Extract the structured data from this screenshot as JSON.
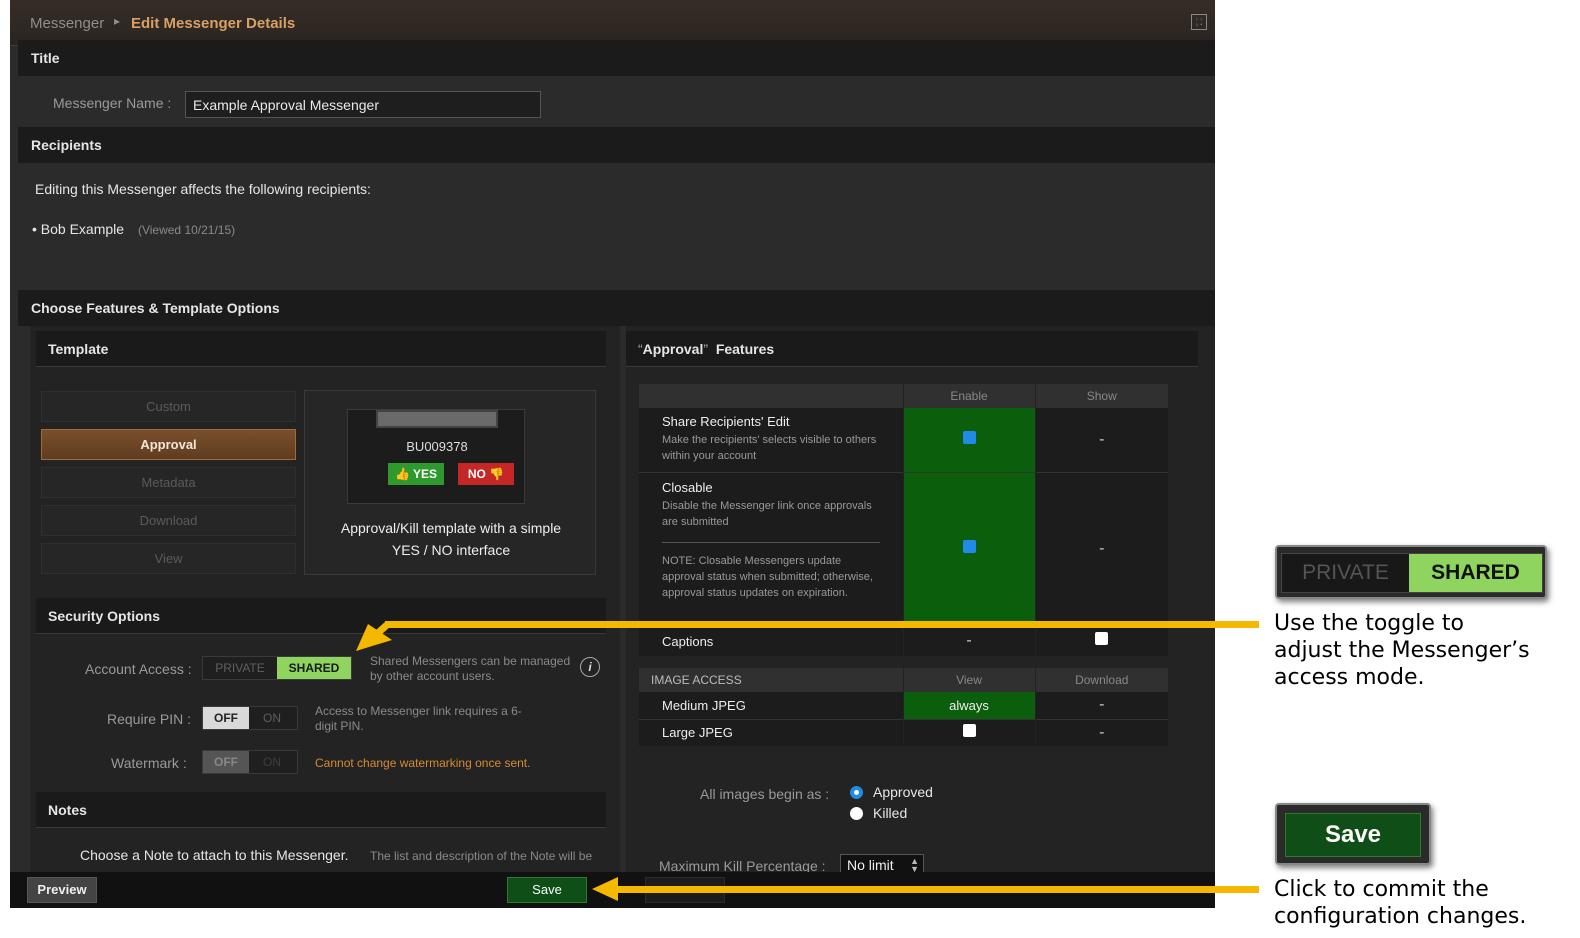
{
  "breadcrumb": {
    "parent": "Messenger",
    "current": "Edit Messenger Details"
  },
  "sections": {
    "title": "Title",
    "recipients": "Recipients",
    "features": "Choose Features & Template Options"
  },
  "messenger_name": {
    "label": "Messenger Name :",
    "value": "Example Approval Messenger"
  },
  "recipients": {
    "intro": "Editing this Messenger affects the following recipients:",
    "items": [
      {
        "name": "Bob Example",
        "viewed": "(Viewed 10/21/15)"
      }
    ]
  },
  "template": {
    "header": "Template",
    "options": [
      "Custom",
      "Approval",
      "Metadata",
      "Download",
      "View"
    ],
    "selected": "Approval",
    "preview_code": "BU009378",
    "yes_label": "YES",
    "no_label": "NO",
    "description_line1": "Approval/Kill template with a simple",
    "description_line2": "YES / NO interface"
  },
  "security": {
    "header": "Security Options",
    "account_access": {
      "label": "Account Access :",
      "off": "PRIVATE",
      "on": "SHARED",
      "note": "Shared Messengers can be managed by other account users."
    },
    "require_pin": {
      "label": "Require PIN :",
      "off": "OFF",
      "on": "ON",
      "note": "Access to Messenger link requires a 6-digit PIN."
    },
    "watermark": {
      "label": "Watermark :",
      "off": "OFF",
      "on": "ON",
      "note": "Cannot change watermarking once sent."
    }
  },
  "notes": {
    "header": "Notes",
    "prompt": "Choose a Note to attach to this Messenger.",
    "hint": "The list and description of the Note will be"
  },
  "approval_features": {
    "header_quoted": "Approval",
    "header_rest": "Features",
    "col_enable": "Enable",
    "col_show": "Show",
    "rows": [
      {
        "title": "Share Recipients' Edit",
        "desc": "Make the recipients' selects visible to others within your account",
        "enable": "checked",
        "show": "-"
      },
      {
        "title": "Closable",
        "desc": "Disable the Messenger link once approvals are submitted",
        "note": "NOTE: Closable Messengers update approval status when submitted; otherwise, approval status updates on expiration.",
        "enable": "checked",
        "show": "-"
      },
      {
        "title": "Captions",
        "enable": "-",
        "show": "unchecked"
      }
    ],
    "image_access": {
      "header": "IMAGE ACCESS",
      "col_view": "View",
      "col_download": "Download",
      "rows": [
        {
          "title": "Medium JPEG",
          "view": "always",
          "download": "-"
        },
        {
          "title": "Large JPEG",
          "view": "unchecked",
          "download": "-"
        }
      ]
    },
    "begin_as": {
      "label": "All images begin as :",
      "options": [
        "Approved",
        "Killed"
      ],
      "selected": "Approved"
    },
    "max_kill": {
      "label": "Maximum Kill Percentage :",
      "value": "No limit"
    }
  },
  "footer": {
    "preview": "Preview",
    "save": "Save"
  },
  "callouts": {
    "toggle_off": "PRIVATE",
    "toggle_on": "SHARED",
    "toggle_text": [
      "Use the toggle to",
      "adjust the Messenger’s",
      "access mode."
    ],
    "save_label": "Save",
    "save_text": [
      "Click to commit the",
      "configuration changes."
    ]
  },
  "colors": {
    "accent_orange": "#d9a066",
    "enable_green": "#0b5e0b",
    "shared_green": "#8fd45f",
    "arrow_yellow": "#f5b800",
    "warning_orange": "#d98a2e"
  },
  "icons": [
    "expand-icon",
    "breadcrumb-chevron-icon",
    "thumbs-up-icon",
    "thumbs-down-icon",
    "info-icon",
    "select-arrows-icon"
  ]
}
